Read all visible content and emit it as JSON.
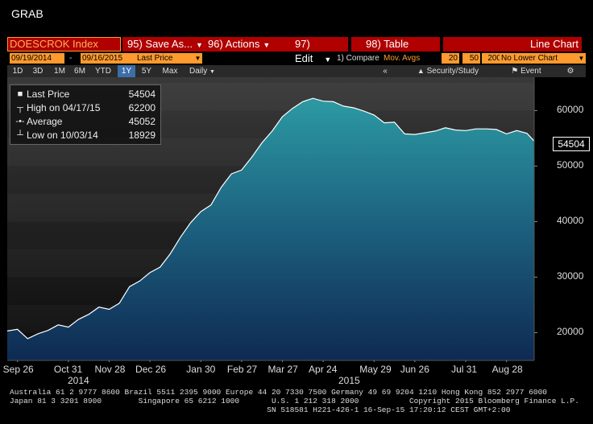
{
  "title": "GRAB",
  "toolbar": {
    "ticker": "DOESCROK Index",
    "save": "95) Save As...",
    "actions": "96) Actions",
    "edit": "97) Edit",
    "table": "98) Table",
    "chart_type": "Line Chart"
  },
  "fields": {
    "start_date": "09/19/2014",
    "dash": "-",
    "end_date": "09/16/2015",
    "price_field": "Last Price",
    "compare_label": "1) Compare",
    "mov_avgs": "Mov. Avgs",
    "ma1": "20",
    "ma2": "50",
    "ma3": "200",
    "lower_chart": "No Lower Chart"
  },
  "periods": [
    "1D",
    "3D",
    "1M",
    "6M",
    "YTD",
    "1Y",
    "5Y",
    "Max"
  ],
  "selected_period": "1Y",
  "frequency": "Daily",
  "toolbar2": {
    "collapse": "«",
    "security_study": "Security/Study",
    "event": "Event",
    "gear": "⚙"
  },
  "legend": {
    "last_label": "Last Price",
    "last_value": "54504",
    "high_label": "High on 04/17/15",
    "high_value": "62200",
    "avg_label": "Average",
    "avg_value": "45052",
    "low_label": "Low on 10/03/14",
    "low_value": "18929"
  },
  "last_price_tag": "54504",
  "chart_data": {
    "type": "area",
    "ylim": [
      15000,
      66000
    ],
    "yticks": [
      "20000",
      "30000",
      "40000",
      "50000",
      "60000"
    ],
    "xticks": [
      "Sep 26",
      "Oct 31",
      "Nov 28",
      "Dec 26",
      "Jan 30",
      "Feb 27",
      "Mar 27",
      "Apr 24",
      "May 29",
      "Jun 26",
      "Jul 31",
      "Aug 28"
    ],
    "years": [
      "2014",
      "2015"
    ],
    "series": [
      {
        "x": [
          "2014-09-19",
          "2014-09-26",
          "2014-10-03",
          "2014-10-10",
          "2014-10-17",
          "2014-10-24",
          "2014-10-31",
          "2014-11-07",
          "2014-11-14",
          "2014-11-21",
          "2014-11-28",
          "2014-12-05",
          "2014-12-12",
          "2014-12-19",
          "2014-12-26",
          "2015-01-02",
          "2015-01-09",
          "2015-01-16",
          "2015-01-23",
          "2015-01-30",
          "2015-02-06",
          "2015-02-13",
          "2015-02-20",
          "2015-02-27",
          "2015-03-06",
          "2015-03-13",
          "2015-03-20",
          "2015-03-27",
          "2015-04-03",
          "2015-04-10",
          "2015-04-17",
          "2015-04-24",
          "2015-05-01",
          "2015-05-08",
          "2015-05-15",
          "2015-05-22",
          "2015-05-29",
          "2015-06-05",
          "2015-06-12",
          "2015-06-19",
          "2015-06-26",
          "2015-07-03",
          "2015-07-10",
          "2015-07-17",
          "2015-07-24",
          "2015-07-31",
          "2015-08-07",
          "2015-08-14",
          "2015-08-21",
          "2015-08-28",
          "2015-09-04",
          "2015-09-11",
          "2015-09-16"
        ],
        "values": [
          20300,
          20600,
          18929,
          19800,
          20400,
          21400,
          21000,
          22400,
          23300,
          24600,
          24200,
          25300,
          28300,
          29300,
          30800,
          31800,
          34200,
          37200,
          39800,
          41800,
          43000,
          46200,
          48600,
          49300,
          51600,
          54200,
          56300,
          58900,
          60400,
          61600,
          62200,
          61700,
          61600,
          60800,
          60500,
          59900,
          59200,
          57800,
          57900,
          55800,
          55700,
          56000,
          56300,
          56900,
          56500,
          56400,
          56700,
          56700,
          56600,
          55800,
          56400,
          55900,
          54504
        ]
      }
    ]
  },
  "footer": {
    "line1": "Australia 61 2 9777 8600 Brazil 5511 2395 9000 Europe 44 20 7330 7500 Germany 49 69 9204 1210 Hong Kong 852 2977 6000",
    "line2": "Japan 81 3 3201 8900        Singapore 65 6212 1000       U.S. 1 212 318 2000           Copyright 2015 Bloomberg Finance L.P.",
    "line3": "                                                        SN 518581 H221-426-1 16-Sep-15 17:20:12 CEST GMT+2:00"
  }
}
